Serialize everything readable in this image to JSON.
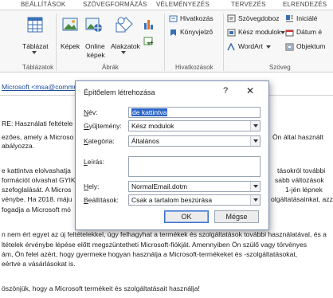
{
  "tabs": [
    "BEÁLLÍTÁSOK",
    "SZÖVEGFORMÁZÁS",
    "VÉLEMÉNYEZÉS",
    "TERVEZÉS",
    "ELRENDEZÉS"
  ],
  "ribbon": {
    "tablazat": "Táblázat",
    "kepek": "Képek",
    "online_kepek_1": "Online",
    "online_kepek_2": "képek",
    "alakzatok": "Alakzatok",
    "hivatkozas": "Hivatkozás",
    "konyvjelzo": "Könyvjelző",
    "szovegdoboz": "Szövegdoboz",
    "keszmodulok": "Kész modulok",
    "wordart": "WordArt",
    "iniciale": "Iniciálé",
    "datum": "Dátum é",
    "objektum": "Objektum",
    "groups": {
      "tablazatok": "Táblázatok",
      "abrak": "Ábrák",
      "hivatkozasok": "Hivatkozások",
      "szoveg": "Szöveg"
    }
  },
  "document": {
    "header_to": "Microsoft <msa@commu",
    "subject": "RE: Használati feltétele",
    "lines": [
      "ezőes, amely a Microso",
      "abályozza.",
      "e kattintva elolvashatja",
      "formációt olvashat GYIK",
      "szefoglalását. A Micros",
      "vénybe. Ha 2018. máju",
      "fogadja a Microsoft mó",
      "n nem ért egyet az új feltételekkel, úgy felhagyhat a termékek és szolgáltatások további használatával, és a",
      "ltételek érvénybe lépése előtt megszüntetheti Microsoft-fiókját. Amennyiben Ön szülő vagy törvényes",
      "ám, Ön felel azért, hogy gyermeke hogyan használja a Microsoft-termékeket és -szolgáltatásokat,",
      "eértve a vásárlásokat is.",
      "öszönjük, hogy a Microsoft termékeit és szolgáltatásait használja!"
    ],
    "right_lines": [
      "Ön által használt",
      "tásokról további",
      "sabb változások",
      "1-jén lépnek",
      "olgáltatásainkat, azzal"
    ]
  },
  "dialog": {
    "title": "Építőelem létrehozása",
    "help": "?",
    "close": "✕",
    "labels": {
      "nev": "Név:",
      "gyujtemeny": "Gyűjtemény:",
      "kategoria": "Kategória:",
      "leiras": "Leírás:",
      "hely": "Hely:",
      "beallitasok": "Beállítások:"
    },
    "values": {
      "nev": "de kattintva",
      "gyujtemeny": "Kész modulok",
      "kategoria": "Általános",
      "leiras": "",
      "hely": "NormalEmail.dotm",
      "beallitasok": "Csak a tartalom beszúrása"
    },
    "ok": "OK",
    "cancel": "Mégse"
  },
  "colors": {
    "accent": "#2b64c6",
    "link": "#1a4c9c",
    "ribbon_bg": "#f7f7f7"
  }
}
